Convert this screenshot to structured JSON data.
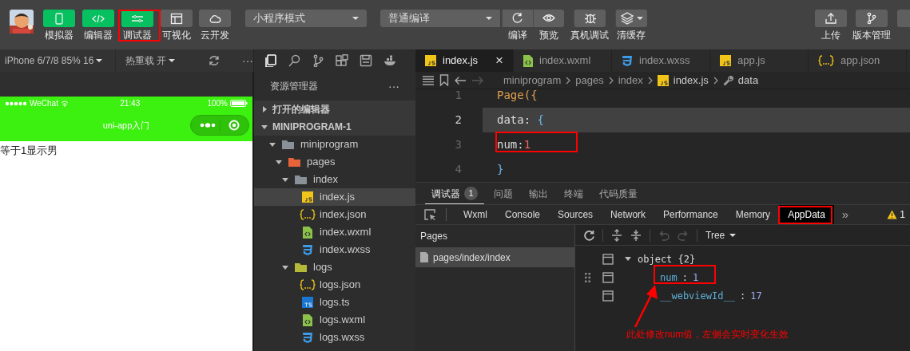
{
  "toolbar": {
    "mode_buttons": [
      {
        "label": "模拟器",
        "on": true
      },
      {
        "label": "编辑器",
        "on": true
      },
      {
        "label": "调试器",
        "on": true
      },
      {
        "label": "可视化",
        "on": false
      },
      {
        "label": "云开发",
        "on": false
      }
    ],
    "mode_select": "小程序模式",
    "compile_select": "普通编译",
    "actions": [
      {
        "label": "编译"
      },
      {
        "label": "预览"
      },
      {
        "label": "真机调试"
      },
      {
        "label": "清缓存"
      }
    ],
    "right_actions": [
      {
        "label": "上传"
      },
      {
        "label": "版本管理"
      }
    ]
  },
  "simulator": {
    "device": "iPhone 6/7/8 85% 16",
    "hot_reload": "热重载 开",
    "more": "···",
    "status": {
      "carrier": "WeChat",
      "time": "21:43",
      "battery": "100%"
    },
    "nav_title": "uni-app入门",
    "content": "等于1显示男"
  },
  "explorer": {
    "title": "资源管理器",
    "more": "···",
    "sections": [
      {
        "label": "打开的编辑器",
        "expanded": false
      },
      {
        "label": "MINIPROGRAM-1",
        "expanded": true,
        "children": [
          {
            "label": "miniprogram",
            "kind": "folder",
            "color": "#8a9199",
            "expanded": true,
            "selected": false,
            "children": [
              {
                "label": "pages",
                "kind": "folder",
                "color": "#e8623a",
                "expanded": true,
                "selected": false,
                "children": [
                  {
                    "label": "index",
                    "kind": "folder",
                    "color": "#8a9199",
                    "expanded": true,
                    "selected": false,
                    "children": [
                      {
                        "label": "index.js",
                        "kind": "js",
                        "selected": true
                      },
                      {
                        "label": "index.json",
                        "kind": "json",
                        "selected": false
                      },
                      {
                        "label": "index.wxml",
                        "kind": "wxml",
                        "selected": false
                      },
                      {
                        "label": "index.wxss",
                        "kind": "wxss",
                        "selected": false
                      }
                    ]
                  },
                  {
                    "label": "logs",
                    "kind": "folder",
                    "color": "#b5b93a",
                    "expanded": true,
                    "selected": false,
                    "children": [
                      {
                        "label": "logs.json",
                        "kind": "json",
                        "selected": false
                      },
                      {
                        "label": "logs.ts",
                        "kind": "ts",
                        "selected": false
                      },
                      {
                        "label": "logs.wxml",
                        "kind": "wxml",
                        "selected": false
                      },
                      {
                        "label": "logs.wxss",
                        "kind": "wxss",
                        "selected": false
                      }
                    ]
                  }
                ]
              }
            ]
          }
        ]
      }
    ]
  },
  "editor_tabs": [
    {
      "label": "index.js",
      "kind": "js",
      "selected": true,
      "close": "×"
    },
    {
      "label": "index.wxml",
      "kind": "wxml",
      "selected": false
    },
    {
      "label": "index.wxss",
      "kind": "wxss",
      "selected": false
    },
    {
      "label": "app.js",
      "kind": "js",
      "selected": false
    },
    {
      "label": "app.json",
      "kind": "json",
      "selected": false
    }
  ],
  "breadcrumb": [
    {
      "label": "miniprogram",
      "kind": "folder"
    },
    {
      "label": "pages",
      "kind": "folder"
    },
    {
      "label": "index",
      "kind": "folder"
    },
    {
      "label": "index.js",
      "kind": "js"
    },
    {
      "label": "data",
      "kind": "property"
    }
  ],
  "code": [
    {
      "line": "1",
      "current": false,
      "tokens": [
        {
          "t": "Page({",
          "kind": "call"
        }
      ]
    },
    {
      "line": "2",
      "current": true,
      "tokens": [
        {
          "t": "data: ",
          "kind": "key"
        },
        {
          "t": "{",
          "kind": "bracket"
        }
      ]
    },
    {
      "line": "3",
      "current": false,
      "tokens": [
        {
          "t": "num:",
          "kind": "key"
        },
        {
          "t": "1",
          "kind": "number"
        }
      ]
    },
    {
      "line": "4",
      "current": false,
      "tokens": [
        {
          "t": "}",
          "kind": "bracket"
        }
      ]
    }
  ],
  "panel_tabs": [
    {
      "label": "调试器",
      "badge": "1",
      "selected": true
    },
    {
      "label": "问题",
      "selected": false
    },
    {
      "label": "输出",
      "selected": false
    },
    {
      "label": "终端",
      "selected": false
    },
    {
      "label": "代码质量",
      "selected": false
    }
  ],
  "devtools_tabs": [
    {
      "label": "Wxml",
      "selected": false
    },
    {
      "label": "Console",
      "selected": false
    },
    {
      "label": "Sources",
      "selected": false
    },
    {
      "label": "Network",
      "selected": false
    },
    {
      "label": "Performance",
      "selected": false
    },
    {
      "label": "Memory",
      "selected": false
    },
    {
      "label": "AppData",
      "selected": true
    }
  ],
  "devtools_more": "»",
  "warnings": "1",
  "pages": {
    "title": "Pages",
    "items": [
      {
        "label": "pages/index/index",
        "selected": true
      }
    ]
  },
  "appdata": {
    "view": "Tree",
    "separator": ":",
    "root": {
      "label": "object {2}",
      "expanded": true
    },
    "entries": [
      {
        "key": "num",
        "value": "1"
      },
      {
        "key": "__webviewId__",
        "value": "17"
      }
    ]
  },
  "annotation": {
    "note": "此处修改num值，左侧会实时变化生效"
  }
}
